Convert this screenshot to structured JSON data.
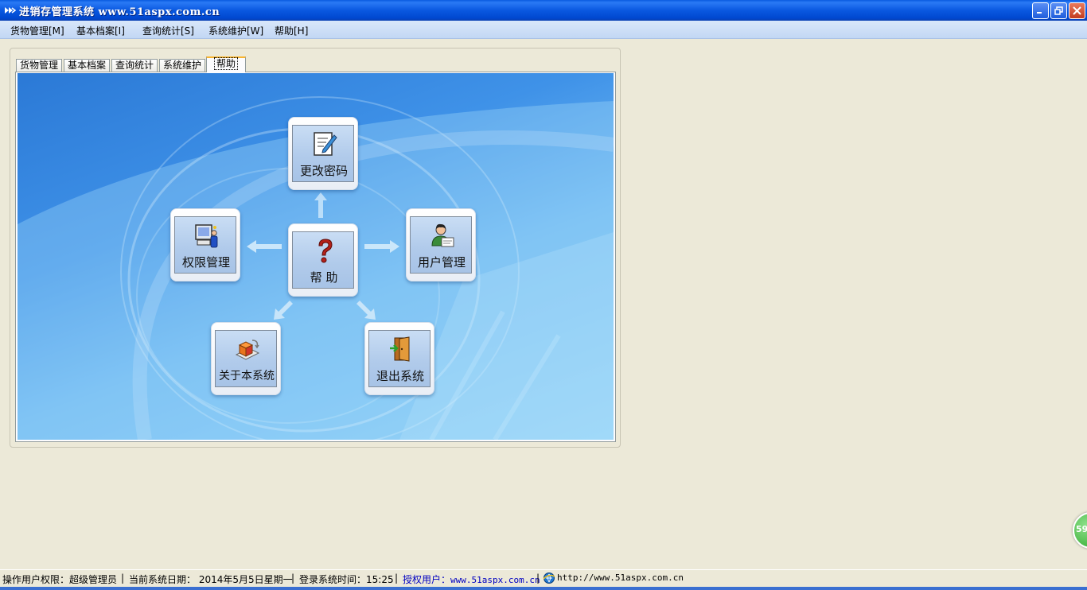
{
  "window": {
    "title": "进销存管理系统 www.51aspx.com.cn"
  },
  "menu": [
    {
      "label": "货物管理[M]"
    },
    {
      "label": "基本档案[I]"
    },
    {
      "label": "查询统计[S]"
    },
    {
      "label": "系统维护[W]"
    },
    {
      "label": "帮助[H]"
    }
  ],
  "tabs": [
    {
      "label": "货物管理"
    },
    {
      "label": "基本档案"
    },
    {
      "label": "查询统计"
    },
    {
      "label": "系统维护"
    },
    {
      "label": "帮助",
      "active": true
    }
  ],
  "help_panel": {
    "buttons": {
      "change_password": {
        "label": "更改密码",
        "icon": "edit-document-icon"
      },
      "permissions": {
        "label": "权限管理",
        "icon": "computer-user-icon"
      },
      "help": {
        "label": "帮 助",
        "icon": "question-mark-icon"
      },
      "user_management": {
        "label": "用户管理",
        "icon": "user-card-icon"
      },
      "about": {
        "label": "关于本系统",
        "icon": "box-icon"
      },
      "exit": {
        "label": "退出系统",
        "icon": "exit-door-icon"
      }
    }
  },
  "side_widget": {
    "text": "59"
  },
  "status": {
    "permission_label": "操作用户权限：",
    "permission_value": "超级管理员",
    "date_label": "当前系统日期：",
    "date_value": "2014年5月5日星期一",
    "time_label": "登录系统时间：",
    "time_value": "15:25",
    "licensed_label": "授权用户：",
    "licensed_value": "www.51aspx.com.cn",
    "url": "http://www.51aspx.com.cn"
  },
  "colors": {
    "title_bar": "#0a58e0",
    "accent_tab": "#f8b430",
    "link": "#0000c0"
  }
}
